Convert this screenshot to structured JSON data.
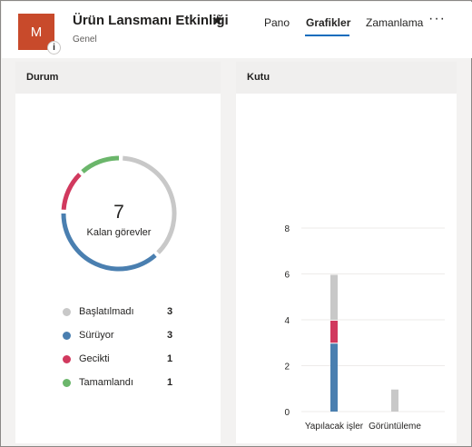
{
  "header": {
    "avatar_letter": "M",
    "info_badge": "i",
    "title": "Ürün Lansmanı Etkinliği",
    "star": "★",
    "group": "Genel",
    "tabs": [
      {
        "label": "Pano",
        "active": false
      },
      {
        "label": "Grafikler",
        "active": true
      },
      {
        "label": "Zamanlama",
        "active": false
      }
    ],
    "more": "···",
    "colors": {
      "avatar": "#c84a2b",
      "accent": "#0f6cbd"
    }
  },
  "status_card": {
    "title": "Durum",
    "center_value": "7",
    "center_label": "Kalan görevler",
    "legend": [
      {
        "label": "Başlatılmadı",
        "count": "3",
        "color": "#c8c8c8"
      },
      {
        "label": "Sürüyor",
        "count": "3",
        "color": "#4a7fb0"
      },
      {
        "label": "Gecikti",
        "count": "1",
        "color": "#d1395e"
      },
      {
        "label": "Tamamlandı",
        "count": "1",
        "color": "#6bb66b"
      }
    ]
  },
  "bucket_card": {
    "title": "Kutu"
  },
  "chart_data": [
    {
      "type": "pie",
      "title": "Durum",
      "categories": [
        "Başlatılmadı",
        "Sürüyor",
        "Gecikti",
        "Tamamlandı"
      ],
      "values": [
        3,
        3,
        1,
        1
      ],
      "colors": [
        "#c8c8c8",
        "#4a7fb0",
        "#d1395e",
        "#6bb66b"
      ],
      "center_text": "7"
    },
    {
      "type": "bar",
      "title": "Kutu",
      "stacked": true,
      "categories": [
        "Yapılacak işler",
        "Görüntüleme"
      ],
      "series": [
        {
          "values": [
            3,
            0
          ],
          "color": "#4a7fb0"
        },
        {
          "values": [
            1,
            0
          ],
          "color": "#d1395e"
        },
        {
          "values": [
            2,
            1
          ],
          "color": "#c8c8c8"
        }
      ],
      "ylim": [
        0,
        8
      ],
      "yticks": [
        0,
        2,
        4,
        6,
        8
      ],
      "grid": true
    }
  ]
}
